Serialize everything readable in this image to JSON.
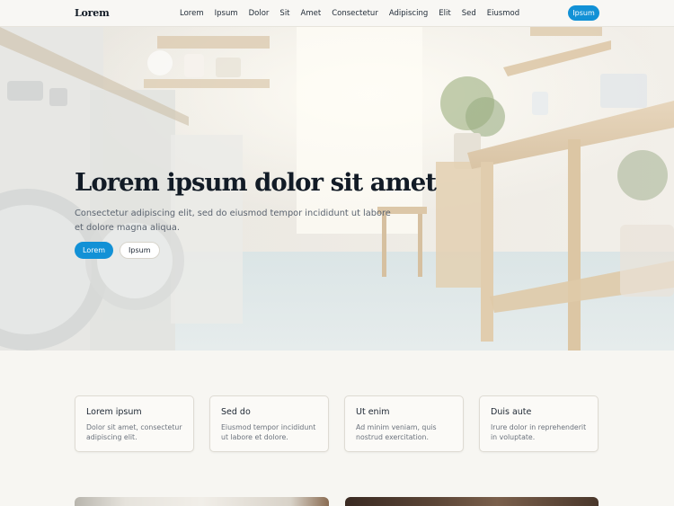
{
  "brand": "Lorem",
  "nav": {
    "links": [
      "Lorem",
      "Ipsum",
      "Dolor",
      "Sit",
      "Amet",
      "Consectetur",
      "Adipiscing",
      "Elit",
      "Sed",
      "Eiusmod"
    ],
    "cta": "Ipsum"
  },
  "hero": {
    "title": "Lorem ipsum dolor sit amet",
    "subtitle": "Consectetur adipiscing elit, sed do eiusmod tempor incididunt ut labore et dolore magna aliqua.",
    "primary_button": "Lorem",
    "secondary_button": "Ipsum"
  },
  "cards": [
    {
      "title": "Lorem ipsum",
      "text": "Dolor sit amet, consectetur adipiscing elit."
    },
    {
      "title": "Sed do",
      "text": "Eiusmod tempor incididunt ut labore et dolore."
    },
    {
      "title": "Ut enim",
      "text": "Ad minim veniam, quis nostrud exercitation."
    },
    {
      "title": "Duis aute",
      "text": "Irure dolor in reprehenderit in voluptate."
    }
  ],
  "colors": {
    "accent": "#1291d6",
    "text_dark": "#121b26",
    "background": "#f7f6f2"
  }
}
